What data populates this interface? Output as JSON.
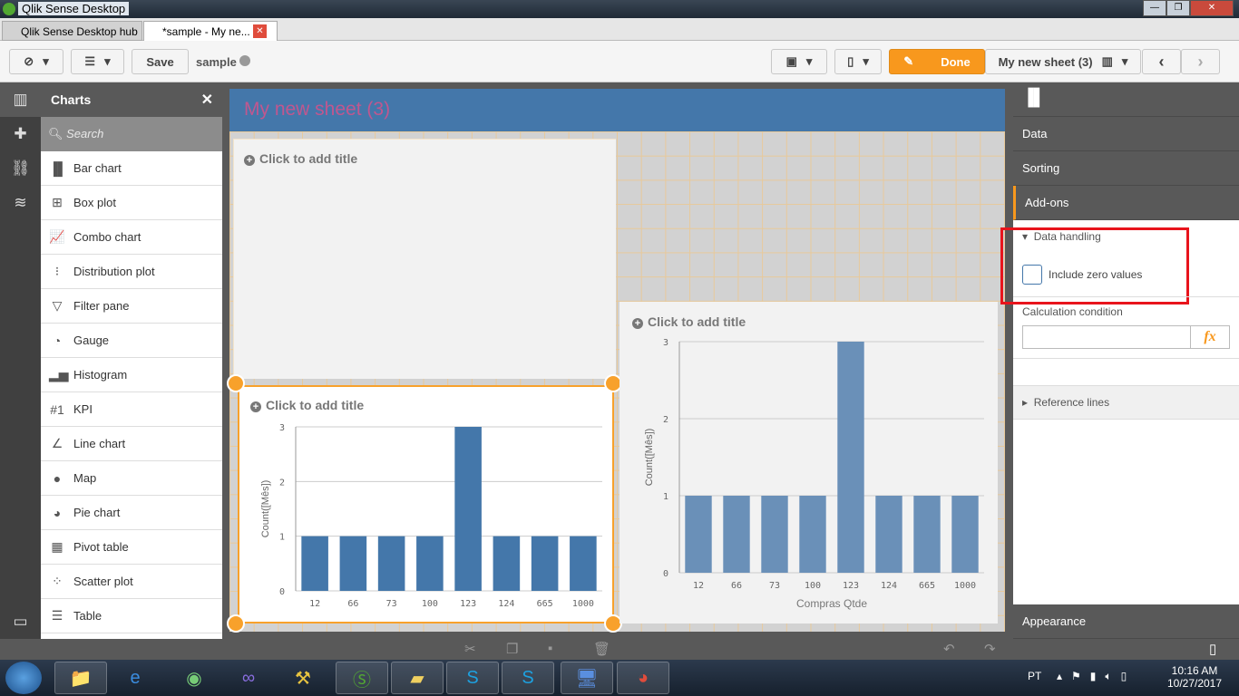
{
  "window": {
    "title": "Qlik Sense Desktop"
  },
  "tabs": [
    {
      "label": "Qlik Sense Desktop hub"
    },
    {
      "label": "*sample - My ne..."
    }
  ],
  "toolbar": {
    "save_label": "Save",
    "app_name": "sample",
    "done_label": "Done",
    "sheet_name": "My new sheet (3)"
  },
  "charts_panel": {
    "title": "Charts",
    "search_placeholder": "Search",
    "items": [
      {
        "label": "Bar chart",
        "icon": "▐▌"
      },
      {
        "label": "Box plot",
        "icon": "⊞"
      },
      {
        "label": "Combo chart",
        "icon": "📈"
      },
      {
        "label": "Distribution plot",
        "icon": "⁝"
      },
      {
        "label": "Filter pane",
        "icon": "▽"
      },
      {
        "label": "Gauge",
        "icon": "◔"
      },
      {
        "label": "Histogram",
        "icon": "▂▅"
      },
      {
        "label": "KPI",
        "icon": "#1"
      },
      {
        "label": "Line chart",
        "icon": "∠"
      },
      {
        "label": "Map",
        "icon": "●"
      },
      {
        "label": "Pie chart",
        "icon": "◕"
      },
      {
        "label": "Pivot table",
        "icon": "▦"
      },
      {
        "label": "Scatter plot",
        "icon": "⁘"
      },
      {
        "label": "Table",
        "icon": "☰"
      }
    ]
  },
  "sheet": {
    "title": "My new sheet (3)",
    "placeholder_title": "Click to add title"
  },
  "chart_data": [
    {
      "type": "bar",
      "title": "Click to add title",
      "categories": [
        "12",
        "66",
        "73",
        "100",
        "123",
        "124",
        "665",
        "1000"
      ],
      "values": [
        1,
        1,
        1,
        1,
        3,
        1,
        1,
        1
      ],
      "ylabel": "Count([Mês])",
      "xlabel": "",
      "ylim": [
        0,
        3
      ],
      "yticks": [
        "0",
        "1",
        "2",
        "3"
      ],
      "color": "#4477aa"
    },
    {
      "type": "bar",
      "title": "Click to add title",
      "categories": [
        "12",
        "66",
        "73",
        "100",
        "123",
        "124",
        "665",
        "1000"
      ],
      "values": [
        1,
        1,
        1,
        1,
        3,
        1,
        1,
        1
      ],
      "ylabel": "Count([Mês])",
      "xlabel": "Compras Qtde",
      "ylim": [
        0,
        3
      ],
      "yticks": [
        "0",
        "1",
        "2",
        "3"
      ],
      "color": "#6a90b8"
    }
  ],
  "properties": {
    "sections": [
      "Data",
      "Sorting",
      "Add-ons"
    ],
    "data_handling": "Data handling",
    "include_zero": "Include zero values",
    "include_zero_checked": false,
    "calc_condition": "Calculation condition",
    "calc_value": "",
    "fx": "fx",
    "reference_lines": "Reference lines",
    "appearance": "Appearance"
  },
  "taskbar": {
    "lang": "PT",
    "time": "10:16 AM",
    "date": "10/27/2017"
  },
  "colors": {
    "accent": "#f8981d",
    "sheet_header": "#4477aa",
    "highlight": "#e8141c"
  }
}
